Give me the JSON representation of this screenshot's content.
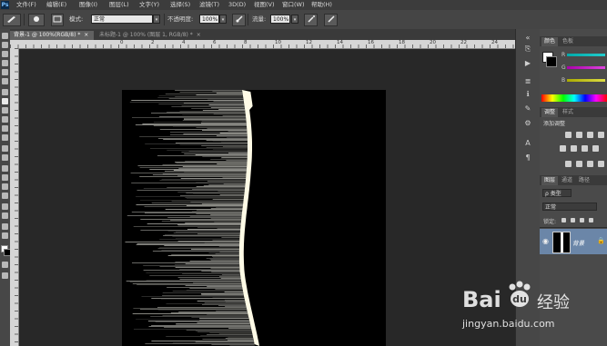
{
  "menubar": {
    "logo": "Ps",
    "items": [
      "文件(F)",
      "编辑(E)",
      "图像(I)",
      "图层(L)",
      "文字(Y)",
      "选择(S)",
      "滤镜(T)",
      "3D(D)",
      "视图(V)",
      "窗口(W)",
      "帮助(H)"
    ]
  },
  "options": {
    "mode_label": "模式:",
    "mode_value": "正常",
    "opacity_label": "不透明度:",
    "opacity_value": "100%",
    "flow_label": "流量:",
    "flow_value": "100%"
  },
  "tabs": [
    {
      "label": "背景-1 @ 100%(RGB/8) *",
      "close": "×",
      "active": true
    },
    {
      "label": "未标题-1 @ 100% (图层 1, RGB/8) *",
      "close": "×",
      "active": false
    }
  ],
  "ruler": {
    "labels": [
      "0",
      "2",
      "4",
      "6",
      "8",
      "10",
      "12",
      "14",
      "16",
      "18",
      "20",
      "22",
      "24",
      "26"
    ]
  },
  "panels": {
    "color_tabs": [
      "颜色",
      "色板"
    ],
    "channels": [
      "R",
      "G",
      "B"
    ],
    "adjust_tabs": [
      "调整",
      "样式"
    ],
    "adjust_title": "添加调整",
    "layers_tabs": [
      "图层",
      "通道",
      "路径"
    ],
    "kind_label": "ρ 类型",
    "blend_value": "正常",
    "lock_label": "锁定:",
    "layer_name": "背景"
  },
  "watermark": {
    "brand_text": "Bai",
    "brand_suffix": "经验",
    "url": "jingyan.baidu.com"
  },
  "colors": {
    "menubar_bg": "#3c3c3c",
    "workspace_bg": "#282828",
    "canvas_bg": "#000000",
    "selected_layer": "#6b86a8",
    "r_slider": "#26c6c6",
    "g_slider": "#c83cc8",
    "b_slider": "#c8c83c"
  }
}
